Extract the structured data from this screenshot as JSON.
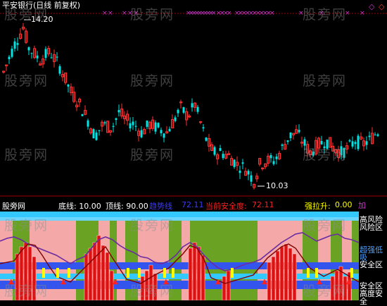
{
  "header": {
    "title": "平安银行(日线 前复权)",
    "high_price_label": "14.20",
    "low_price_label": "10.03"
  },
  "watermark": "股旁网",
  "indicator": {
    "name": "股旁网",
    "di_line_label": "底线: 10.00",
    "ding_line_label": "顶线: 90.00",
    "trend_label": "趋势线",
    "trend_value": "72.11",
    "safety_label": "当前安全度:",
    "safety_value": "72.11",
    "pull_label": "强拉升:",
    "pull_value": "0.00",
    "add_label": "加"
  },
  "right_labels": {
    "high_risk_1": "高风险",
    "high_risk_2": "风险区",
    "buy_1": "超强低",
    "buy_2": "吸",
    "safe_1": "安全区",
    "safe_2": "安全区",
    "safe_3": "高度安全"
  },
  "colors": {
    "bg": "#000000",
    "up": "#ff3030",
    "down": "#00e5e5",
    "green_zone": "#6aa323",
    "pink_zone": "#f4a8a8",
    "cyan_band": "#33c8ff",
    "blue_band": "#3355ee",
    "trend_line": "#6a2ba0",
    "signal_marker": "#cc33cc"
  },
  "price_axis": {
    "min": 10.03,
    "max": 14.2
  }
}
